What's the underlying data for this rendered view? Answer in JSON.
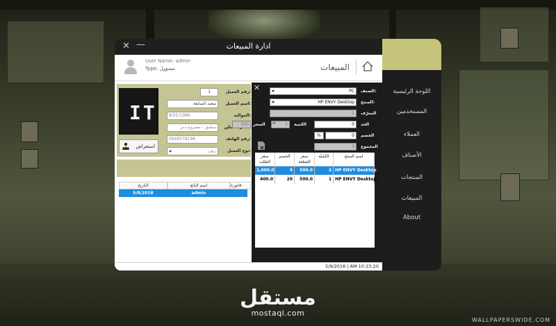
{
  "window": {
    "title": "ادارة المبيعات",
    "close_glyph": "✕",
    "minimize_glyph": "—"
  },
  "header": {
    "user_name": "User Name: admin",
    "type_label": "Type:",
    "type_value": "مسؤول",
    "page_title": "المبيعات"
  },
  "customer": {
    "photo_mark": "IT",
    "browse_label": "استعراض",
    "fields": {
      "id_label": "رقم العميل:",
      "id_value": "1",
      "name_label": "اسم العميل:",
      "name_value": "سعيد الصابغة",
      "dob_label": "المواليد:",
      "dob_value": "8/31/1986",
      "address_label": "مكان السكن:",
      "address_value": "دمشق - مشروع دمر",
      "phone_label": "رقم الهاتف:",
      "phone_value": "0949578196",
      "type_label": "نوع العميل:",
      "type_value": "زبون"
    },
    "sales_table": {
      "columns": [
        "التاريخ",
        "اسم البائع",
        "فاتورة"
      ],
      "rows": [
        {
          "date": "5/8/2018",
          "seller": "admin",
          "invoice": ""
        }
      ]
    }
  },
  "cart": {
    "close_glyph": "✕",
    "category_label": "الصنف:",
    "category_value": "PC",
    "product_label": "المنتج:",
    "product_value": "HP ENVY Desktop",
    "id_label": "المعرّف",
    "id_value": "1",
    "unit_label": "الحد",
    "unit_value": "0",
    "qty_label": "الكمية",
    "qty_value": "2",
    "price_label": "السعر",
    "price_value": "500",
    "discount_label": "الخصم",
    "discount_value": "0",
    "discount_unit": "%",
    "total_label": "المجموع",
    "total_value": "0",
    "table": {
      "columns": [
        "اسم المنتج",
        "الكميّة",
        "سعر القطعة",
        "الخصم",
        "سعر الطلب"
      ],
      "rows": [
        {
          "name": "HP ENVY Desktop",
          "qty": "2",
          "unit_price": "500.0",
          "discount": "0",
          "order_price": "1,000.0",
          "selected": true
        },
        {
          "name": "HP ENVY Desktop",
          "qty": "1",
          "unit_price": "500.0",
          "discount": "20",
          "order_price": "400.0",
          "selected": false
        }
      ]
    }
  },
  "status_bar": {
    "text": "5/9/2018  |  AM 10:23:20"
  },
  "sidebar": {
    "items": [
      "اللوحة الرئيسية",
      "المستخدمين",
      "العملاء",
      "الأصناف",
      "المنتجات",
      "المبيعات",
      "About"
    ]
  },
  "watermark": {
    "brand_ar": "مستقل",
    "brand_en": "mostaql.com",
    "wallpaper_site": "WALLPAPERSWIDE.COM"
  },
  "colors": {
    "olive_accent": "#c5c47a",
    "panel_olive": "#c5c493",
    "selection_blue": "#1f8cdd",
    "dark_panel": "#1b1b1b"
  },
  "icons": [
    "home-icon",
    "user-avatar-icon",
    "close-icon",
    "minimize-icon",
    "browse-icon",
    "delete-icon",
    "dropdown-icon"
  ]
}
